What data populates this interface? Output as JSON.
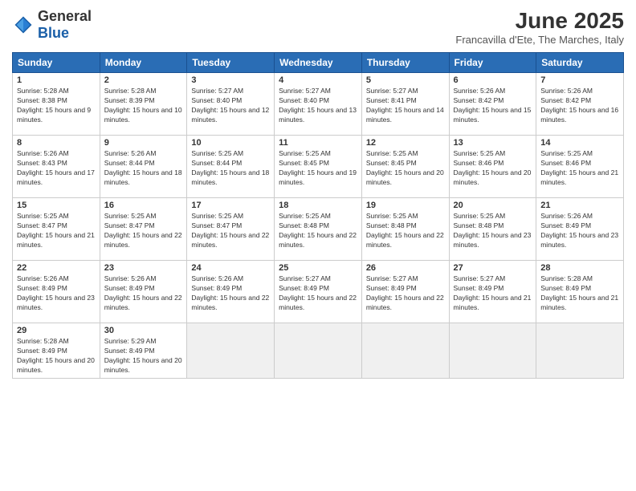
{
  "header": {
    "logo_general": "General",
    "logo_blue": "Blue",
    "month": "June 2025",
    "location": "Francavilla d'Ete, The Marches, Italy"
  },
  "days_of_week": [
    "Sunday",
    "Monday",
    "Tuesday",
    "Wednesday",
    "Thursday",
    "Friday",
    "Saturday"
  ],
  "weeks": [
    [
      {
        "day": "1",
        "sunrise": "5:28 AM",
        "sunset": "8:38 PM",
        "daylight": "15 hours and 9 minutes."
      },
      {
        "day": "2",
        "sunrise": "5:28 AM",
        "sunset": "8:39 PM",
        "daylight": "15 hours and 10 minutes."
      },
      {
        "day": "3",
        "sunrise": "5:27 AM",
        "sunset": "8:40 PM",
        "daylight": "15 hours and 12 minutes."
      },
      {
        "day": "4",
        "sunrise": "5:27 AM",
        "sunset": "8:40 PM",
        "daylight": "15 hours and 13 minutes."
      },
      {
        "day": "5",
        "sunrise": "5:27 AM",
        "sunset": "8:41 PM",
        "daylight": "15 hours and 14 minutes."
      },
      {
        "day": "6",
        "sunrise": "5:26 AM",
        "sunset": "8:42 PM",
        "daylight": "15 hours and 15 minutes."
      },
      {
        "day": "7",
        "sunrise": "5:26 AM",
        "sunset": "8:42 PM",
        "daylight": "15 hours and 16 minutes."
      }
    ],
    [
      {
        "day": "8",
        "sunrise": "5:26 AM",
        "sunset": "8:43 PM",
        "daylight": "15 hours and 17 minutes."
      },
      {
        "day": "9",
        "sunrise": "5:26 AM",
        "sunset": "8:44 PM",
        "daylight": "15 hours and 18 minutes."
      },
      {
        "day": "10",
        "sunrise": "5:25 AM",
        "sunset": "8:44 PM",
        "daylight": "15 hours and 18 minutes."
      },
      {
        "day": "11",
        "sunrise": "5:25 AM",
        "sunset": "8:45 PM",
        "daylight": "15 hours and 19 minutes."
      },
      {
        "day": "12",
        "sunrise": "5:25 AM",
        "sunset": "8:45 PM",
        "daylight": "15 hours and 20 minutes."
      },
      {
        "day": "13",
        "sunrise": "5:25 AM",
        "sunset": "8:46 PM",
        "daylight": "15 hours and 20 minutes."
      },
      {
        "day": "14",
        "sunrise": "5:25 AM",
        "sunset": "8:46 PM",
        "daylight": "15 hours and 21 minutes."
      }
    ],
    [
      {
        "day": "15",
        "sunrise": "5:25 AM",
        "sunset": "8:47 PM",
        "daylight": "15 hours and 21 minutes."
      },
      {
        "day": "16",
        "sunrise": "5:25 AM",
        "sunset": "8:47 PM",
        "daylight": "15 hours and 22 minutes."
      },
      {
        "day": "17",
        "sunrise": "5:25 AM",
        "sunset": "8:47 PM",
        "daylight": "15 hours and 22 minutes."
      },
      {
        "day": "18",
        "sunrise": "5:25 AM",
        "sunset": "8:48 PM",
        "daylight": "15 hours and 22 minutes."
      },
      {
        "day": "19",
        "sunrise": "5:25 AM",
        "sunset": "8:48 PM",
        "daylight": "15 hours and 22 minutes."
      },
      {
        "day": "20",
        "sunrise": "5:25 AM",
        "sunset": "8:48 PM",
        "daylight": "15 hours and 23 minutes."
      },
      {
        "day": "21",
        "sunrise": "5:26 AM",
        "sunset": "8:49 PM",
        "daylight": "15 hours and 23 minutes."
      }
    ],
    [
      {
        "day": "22",
        "sunrise": "5:26 AM",
        "sunset": "8:49 PM",
        "daylight": "15 hours and 23 minutes."
      },
      {
        "day": "23",
        "sunrise": "5:26 AM",
        "sunset": "8:49 PM",
        "daylight": "15 hours and 22 minutes."
      },
      {
        "day": "24",
        "sunrise": "5:26 AM",
        "sunset": "8:49 PM",
        "daylight": "15 hours and 22 minutes."
      },
      {
        "day": "25",
        "sunrise": "5:27 AM",
        "sunset": "8:49 PM",
        "daylight": "15 hours and 22 minutes."
      },
      {
        "day": "26",
        "sunrise": "5:27 AM",
        "sunset": "8:49 PM",
        "daylight": "15 hours and 22 minutes."
      },
      {
        "day": "27",
        "sunrise": "5:27 AM",
        "sunset": "8:49 PM",
        "daylight": "15 hours and 21 minutes."
      },
      {
        "day": "28",
        "sunrise": "5:28 AM",
        "sunset": "8:49 PM",
        "daylight": "15 hours and 21 minutes."
      }
    ],
    [
      {
        "day": "29",
        "sunrise": "5:28 AM",
        "sunset": "8:49 PM",
        "daylight": "15 hours and 20 minutes."
      },
      {
        "day": "30",
        "sunrise": "5:29 AM",
        "sunset": "8:49 PM",
        "daylight": "15 hours and 20 minutes."
      },
      null,
      null,
      null,
      null,
      null
    ]
  ]
}
